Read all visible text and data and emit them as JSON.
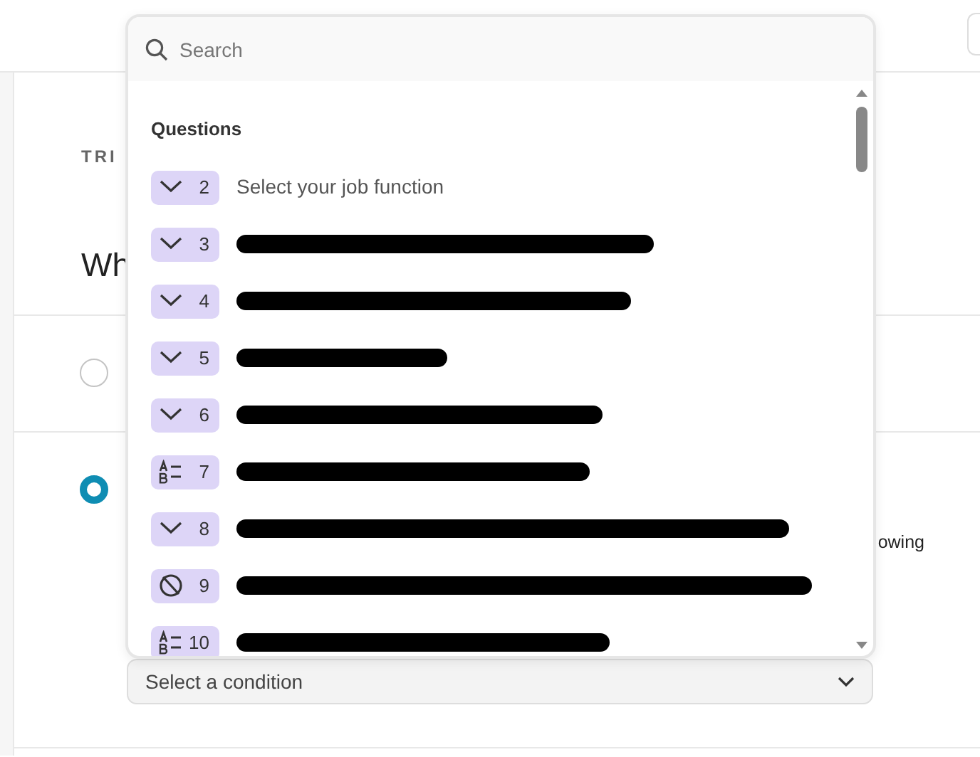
{
  "page": {
    "section_label": "TRI",
    "heading": "Wh",
    "options": [
      {
        "selected": false
      },
      {
        "selected": true,
        "trailing_text": "owing",
        "condition_placeholder": "Select a condition"
      }
    ]
  },
  "dropdown": {
    "search": {
      "placeholder": "Search"
    },
    "group_title": "Questions",
    "items": [
      {
        "kind": "choice",
        "number": "2",
        "label": "Select your job function",
        "redacted": false
      },
      {
        "kind": "choice",
        "number": "3",
        "redacted": true
      },
      {
        "kind": "choice",
        "number": "4",
        "redacted": true
      },
      {
        "kind": "choice",
        "number": "5",
        "redacted": true
      },
      {
        "kind": "choice",
        "number": "6",
        "redacted": true
      },
      {
        "kind": "ranking",
        "number": "7",
        "redacted": true
      },
      {
        "kind": "choice",
        "number": "8",
        "redacted": true
      },
      {
        "kind": "opinion",
        "number": "9",
        "redacted": true
      },
      {
        "kind": "ranking",
        "number": "10",
        "redacted": true
      }
    ]
  }
}
